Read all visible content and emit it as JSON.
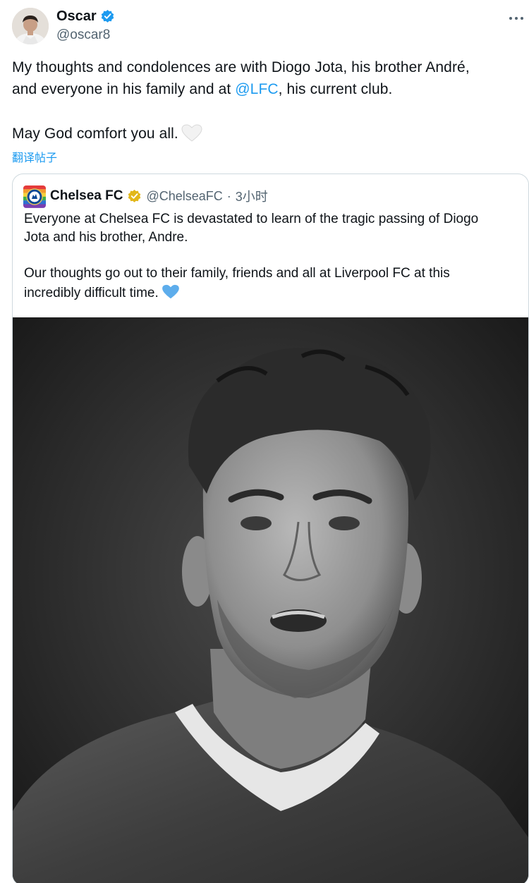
{
  "post": {
    "author_name": "Oscar",
    "author_handle": "@oscar8",
    "avatar_icon": "profile-avatar",
    "verified_color": "#1d9bf0",
    "more_icon": "more-horizontal-icon",
    "text": {
      "line1": "My thoughts and condolences are with Diogo Jota, his brother André,",
      "line2_pre": "and everyone in his family and at ",
      "line2_mention": "@LFC",
      "line2_post": ", his current club.",
      "line3": "May God comfort you all."
    },
    "heart_icon": "white-heart-emoji",
    "translate_label": "翻译帖子"
  },
  "quote": {
    "author_name": "Chelsea FC",
    "author_handle": "@ChelseaFC",
    "separator": "·",
    "time": "3小时",
    "verified_color": "#e2b719",
    "avatar_icon": "chelsea-crest",
    "text": {
      "line1": "Everyone at Chelsea FC is devastated to learn of the tragic passing of Diogo",
      "line2": "Jota and his brother, Andre.",
      "line3": "Our thoughts go out to their family, friends and all at Liverpool FC at this",
      "line4": "incredibly difficult time."
    },
    "heart_icon": "blue-heart-emoji",
    "heart_color": "#5dadec",
    "photo_alt": "black-and-white portrait photo"
  },
  "colors": {
    "text": "#0f1419",
    "secondary": "#536471",
    "link": "#1d9bf0",
    "border": "#cfd9de"
  }
}
